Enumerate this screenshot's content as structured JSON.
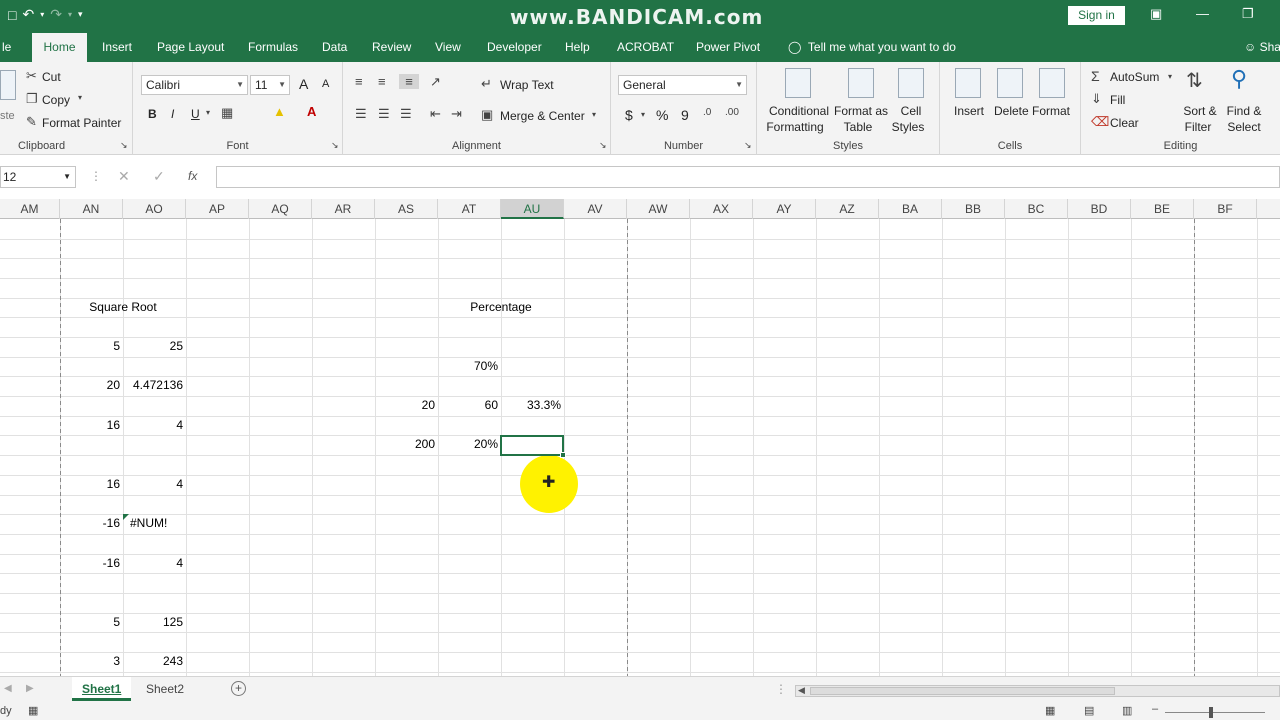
{
  "window": {
    "watermark": "www.BANDICAM.com",
    "signin": "Sign in"
  },
  "tabs": [
    "le",
    "Home",
    "Insert",
    "Page Layout",
    "Formulas",
    "Data",
    "Review",
    "View",
    "Developer",
    "Help",
    "ACROBAT",
    "Power Pivot"
  ],
  "tell_me": "Tell me what you want to do",
  "share": "Sha",
  "ribbon": {
    "clipboard": {
      "cut": "Cut",
      "copy": "Copy",
      "format_painter": "Format Painter",
      "label": "Clipboard",
      "paste_fragment": "ste"
    },
    "font": {
      "name": "Calibri",
      "size": "11",
      "label": "Font",
      "bold": "B",
      "italic": "I",
      "underline": "U",
      "grow": "A",
      "shrink": "A"
    },
    "alignment": {
      "wrap_text": "Wrap Text",
      "merge_center": "Merge & Center",
      "label": "Alignment"
    },
    "number": {
      "format": "General",
      "currency": "$",
      "percent": "%",
      "comma": "9",
      "label": "Number"
    },
    "styles": {
      "conditional_1": "Conditional",
      "conditional_2": "Formatting",
      "format_table_1": "Format as",
      "format_table_2": "Table",
      "cell_styles_1": "Cell",
      "cell_styles_2": "Styles",
      "label": "Styles"
    },
    "cells": {
      "insert": "Insert",
      "delete": "Delete",
      "format": "Format",
      "label": "Cells"
    },
    "editing": {
      "autosum": "AutoSum",
      "fill": "Fill",
      "clear": "Clear",
      "sort_1": "Sort &",
      "sort_2": "Filter",
      "find_1": "Find &",
      "find_2": "Select",
      "label": "Editing"
    }
  },
  "formula_bar": {
    "name_box": "12",
    "fx": "fx",
    "value": ""
  },
  "columns": [
    "AM",
    "AN",
    "AO",
    "AP",
    "AQ",
    "AR",
    "AS",
    "AT",
    "AU",
    "AV",
    "AW",
    "AX",
    "AY",
    "AZ",
    "BA",
    "BB",
    "BC",
    "BD",
    "BE",
    "BF"
  ],
  "selected_column": "AU",
  "cells": {
    "square_root_title": "Square Root",
    "percentage_title": "Percentage",
    "an_r7": "5",
    "ao_r7": "25",
    "an_r9": "20",
    "ao_r9": "4.472136",
    "an_r11": "16",
    "ao_r11": "4",
    "an_r14": "16",
    "ao_r14": "4",
    "an_r16": "-16",
    "ao_r16": "#NUM!",
    "an_r18": "-16",
    "ao_r18": "4",
    "an_r21": "5",
    "ao_r21": "125",
    "an_r23": "3",
    "ao_r23": "243",
    "at_r8": "70%",
    "as_r10": "20",
    "at_r10": "60",
    "au_r10": "33.3%",
    "as_r12": "200",
    "at_r12": "20%"
  },
  "sheets": [
    "Sheet1",
    "Sheet2"
  ],
  "active_sheet": "Sheet1",
  "status": {
    "ready": "dy"
  }
}
